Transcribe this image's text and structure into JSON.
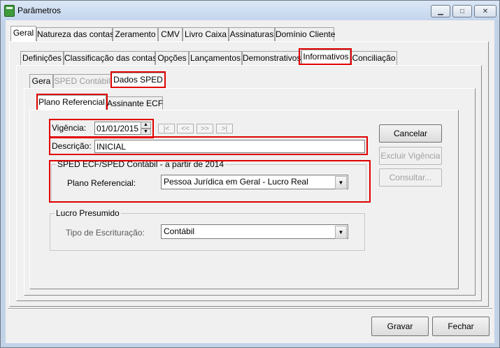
{
  "window": {
    "title": "Parâmetros",
    "minimize_icon": "minimize-icon",
    "maximize_icon": "maximize-icon",
    "close_icon": "close-icon"
  },
  "main_tabs": [
    "Geral",
    "Natureza das contas",
    "Zeramento",
    "CMV",
    "Livro Caixa",
    "Assinaturas",
    "Domínio Cliente"
  ],
  "sub_tabs": [
    "Definições",
    "Classificação das contas",
    "Opções",
    "Lançamentos",
    "Demonstrativos",
    "Informativos",
    "Conciliação"
  ],
  "info_tabs": [
    "Gera",
    "SPED Contábil",
    "Dados SPED"
  ],
  "sped_tabs": [
    "Plano Referencial",
    "Assinante ECF"
  ],
  "form": {
    "vigencia_label": "Vigência:",
    "vigencia_value": "01/01/2015",
    "nav_first": "|<",
    "nav_prev": "<<",
    "nav_next": ">>",
    "nav_last": ">|",
    "descricao_label": "Descrição:",
    "descricao_value": "INICIAL",
    "sped_group_title": "SPED ECF/SPED Contábil - a partir de 2014",
    "plano_label": "Plano Referencial:",
    "plano_value": "Pessoa Jurídica em Geral - Lucro Real",
    "lucro_group_title": "Lucro Presumido",
    "tipo_label": "Tipo de Escrituração:",
    "tipo_value": "Contábil"
  },
  "side_buttons": {
    "cancelar": "Cancelar",
    "excluir": "Excluir Vigência",
    "consultar": "Consultar..."
  },
  "footer": {
    "gravar": "Gravar",
    "fechar": "Fechar"
  },
  "highlight_color": "#e00000"
}
